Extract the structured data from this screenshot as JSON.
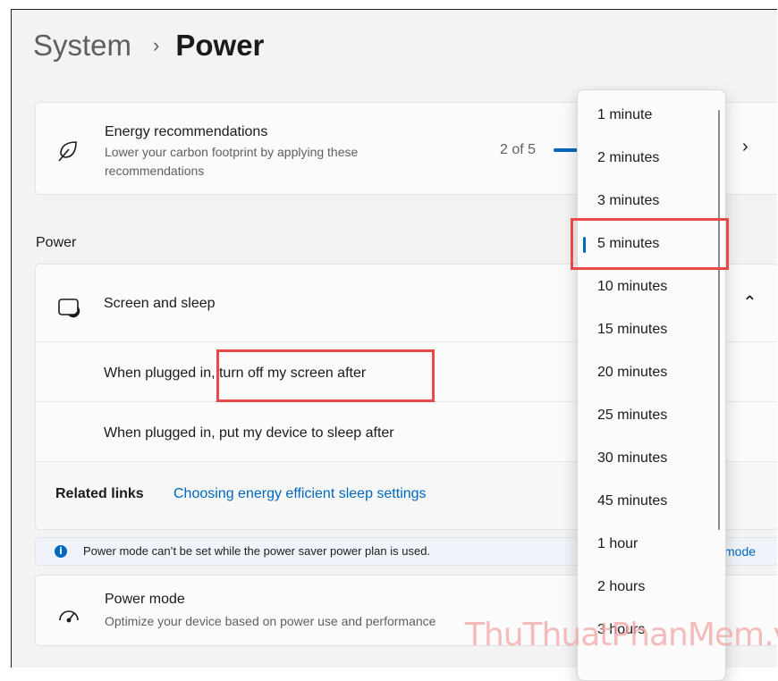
{
  "breadcrumb": {
    "parent": "System",
    "separator": "›",
    "current": "Power"
  },
  "energy": {
    "title": "Energy recommendations",
    "subtitle": "Lower your carbon footprint by applying these recommendations",
    "count": "2 of 5",
    "progress_fraction": 0.4
  },
  "power_section": {
    "label": "Power"
  },
  "screen_sleep": {
    "title": "Screen and sleep",
    "plugged_screen": "When plugged in, turn off my screen after",
    "plugged_sleep": "When plugged in, put my device to sleep after",
    "related_label": "Related links",
    "related_link": "Choosing energy efficient sleep settings"
  },
  "info": {
    "text": "Power mode can’t be set while the power saver power plan is used.",
    "link_fragment": "mode"
  },
  "power_mode": {
    "title": "Power mode",
    "subtitle": "Optimize your device based on power use and performance"
  },
  "dropdown": {
    "selected": "5 minutes",
    "items": [
      "1 minute",
      "2 minutes",
      "3 minutes",
      "5 minutes",
      "10 minutes",
      "15 minutes",
      "20 minutes",
      "25 minutes",
      "30 minutes",
      "45 minutes",
      "1 hour",
      "2 hours",
      "3 hours"
    ]
  },
  "watermark": "ThuThuatPhanMem.vn",
  "colors": {
    "accent": "#0067c0",
    "annotation": "#e84a4a",
    "background": "#f3f3f3"
  },
  "icons": [
    "leaf-icon",
    "chevron-right-icon",
    "screen-sleep-icon",
    "chevron-up-icon",
    "info-icon",
    "gauge-icon"
  ]
}
